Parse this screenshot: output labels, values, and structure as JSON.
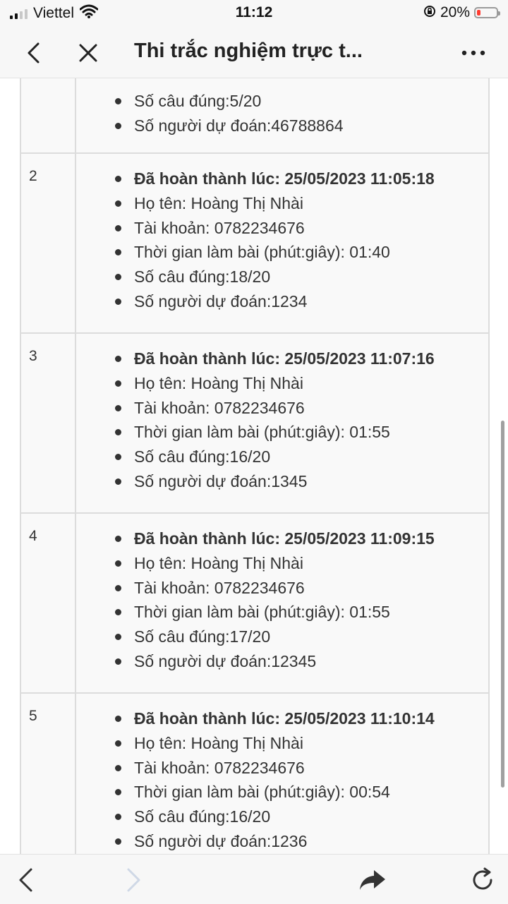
{
  "status_bar": {
    "carrier": "Viettel",
    "time": "11:12",
    "battery_percent": "20%",
    "battery_level": 0.2,
    "battery_color": "#ff3b30",
    "signal_bars_active": 2
  },
  "nav": {
    "title": "Thi trắc nghiệm trực t...",
    "icons": [
      "back-icon",
      "close-icon",
      "more-icon"
    ]
  },
  "results": [
    {
      "number": "",
      "lines": [
        "Số câu đúng:5/20",
        "Số người dự đoán:46788864"
      ]
    },
    {
      "number": "2",
      "completed": "Đã hoàn thành lúc: 25/05/2023 11:05:18",
      "name": "Họ tên: Hoàng Thị Nhài",
      "account": "Tài khoản: 0782234676",
      "duration": "Thời gian làm bài (phút:giây): 01:40",
      "correct": "Số câu đúng:18/20",
      "predicted": "Số người dự đoán:1234"
    },
    {
      "number": "3",
      "completed": "Đã hoàn thành lúc: 25/05/2023 11:07:16",
      "name": "Họ tên: Hoàng Thị Nhài",
      "account": "Tài khoản: 0782234676",
      "duration": "Thời gian làm bài (phút:giây): 01:55",
      "correct": "Số câu đúng:16/20",
      "predicted": "Số người dự đoán:1345"
    },
    {
      "number": "4",
      "completed": "Đã hoàn thành lúc: 25/05/2023 11:09:15",
      "name": "Họ tên: Hoàng Thị Nhài",
      "account": "Tài khoản: 0782234676",
      "duration": "Thời gian làm bài (phút:giây): 01:55",
      "correct": "Số câu đúng:17/20",
      "predicted": "Số người dự đoán:12345"
    },
    {
      "number": "5",
      "completed": "Đã hoàn thành lúc: 25/05/2023 11:10:14",
      "name": "Họ tên: Hoàng Thị Nhài",
      "account": "Tài khoản: 0782234676",
      "duration": "Thời gian làm bài (phút:giây): 00:54",
      "correct": "Số câu đúng:16/20",
      "predicted": "Số người dự đoán:1236"
    }
  ],
  "toolbar": {
    "icons": [
      "back-arrow-icon",
      "forward-arrow-icon",
      "share-icon",
      "reload-icon"
    ]
  }
}
